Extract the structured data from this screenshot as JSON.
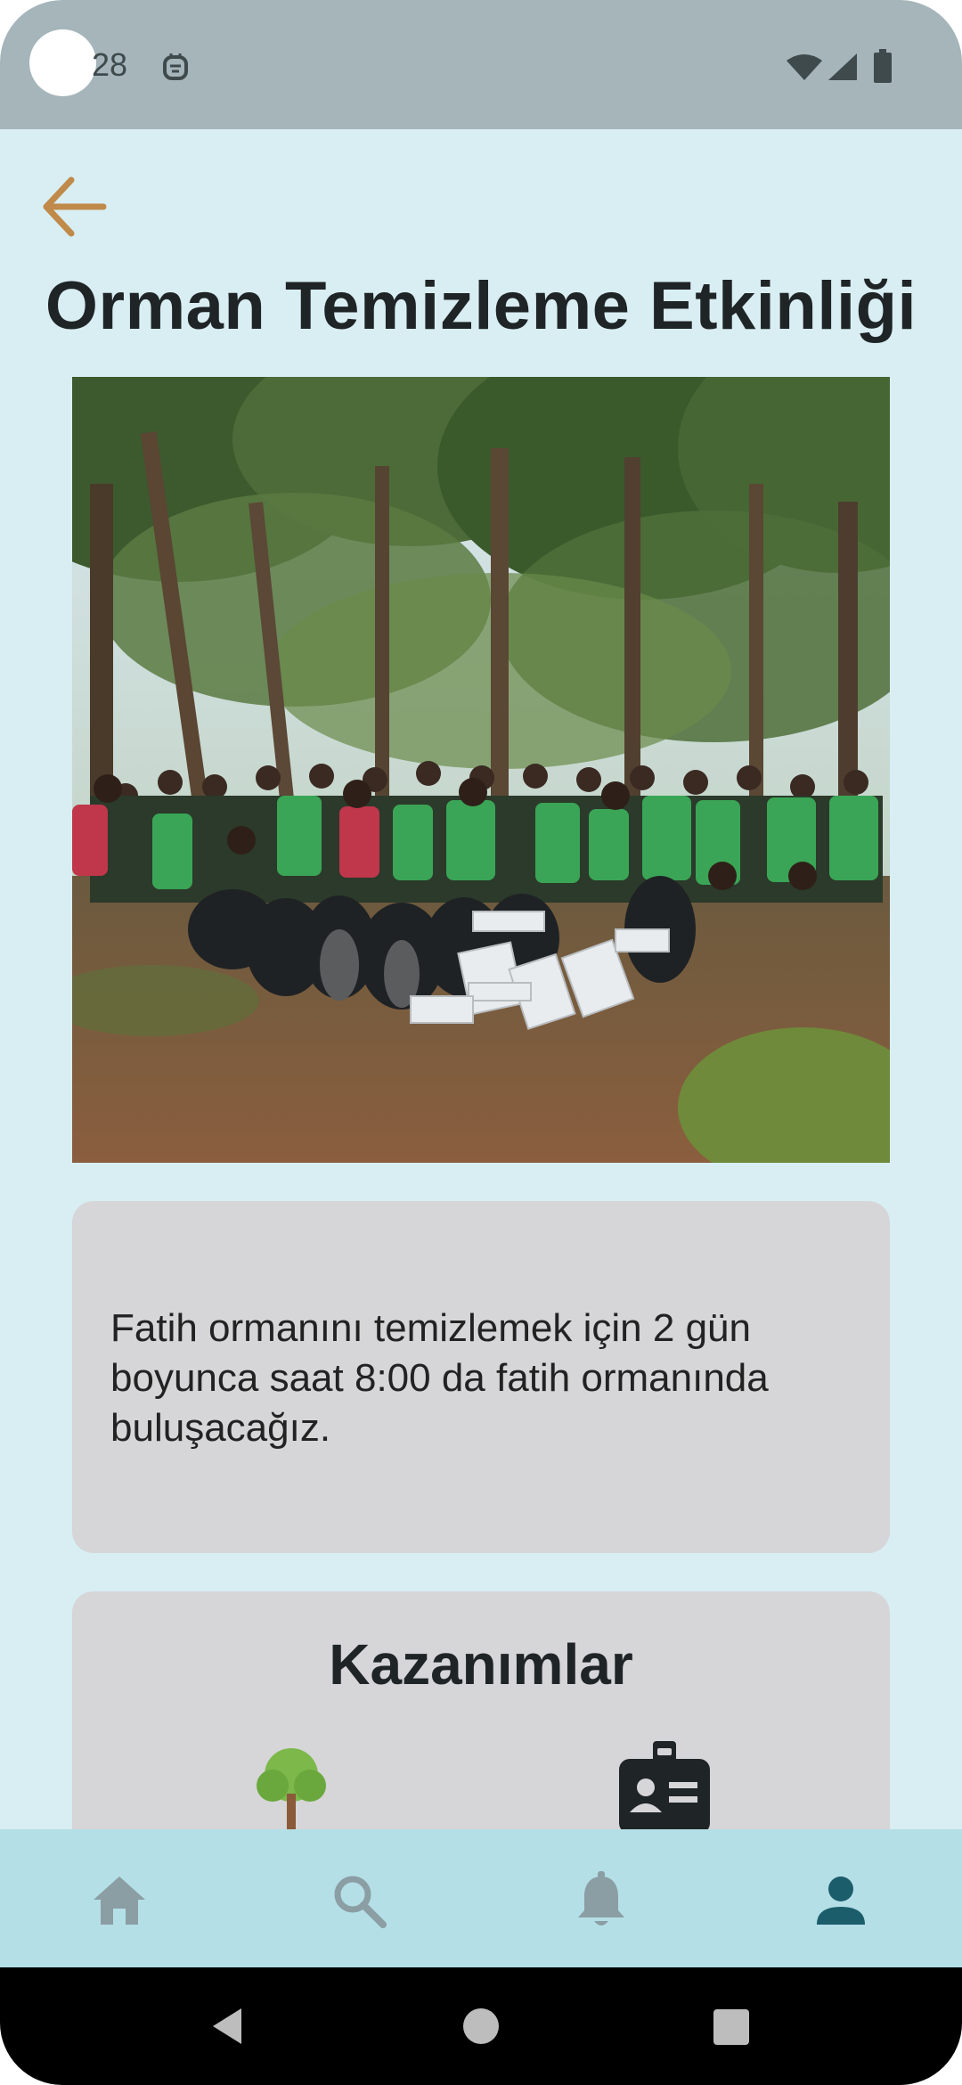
{
  "status_bar": {
    "time": "28",
    "icons": [
      "notification-icon",
      "wifi-icon",
      "signal-icon",
      "battery-icon"
    ]
  },
  "header": {
    "back_icon": "arrow-left-icon",
    "title": "Orman Temizleme Etkinliği"
  },
  "event": {
    "photo_icon": "group-photo-forest-cleanup",
    "description": "Fatih ormanını temizlemek için 2 gün boyunca saat 8:00 da fatih ormanında buluşacağız."
  },
  "gains": {
    "title": "Kazanımlar",
    "items": [
      {
        "icon": "tree-icon"
      },
      {
        "icon": "id-badge-icon"
      }
    ]
  },
  "bottom_nav": {
    "items": [
      {
        "icon": "home-icon",
        "active": false
      },
      {
        "icon": "search-icon",
        "active": false
      },
      {
        "icon": "bell-icon",
        "active": false
      },
      {
        "icon": "person-icon",
        "active": true
      }
    ],
    "colors": {
      "inactive": "#8b9ea3",
      "active": "#1b5d6b"
    }
  },
  "system_nav": {
    "icons": [
      "back-triangle-icon",
      "home-circle-icon",
      "recents-square-icon"
    ]
  },
  "colors": {
    "background": "#d8eef3",
    "accent": "#c08a4a",
    "card": "#d6d5d7",
    "nav_bar": "#b4dfe7"
  }
}
